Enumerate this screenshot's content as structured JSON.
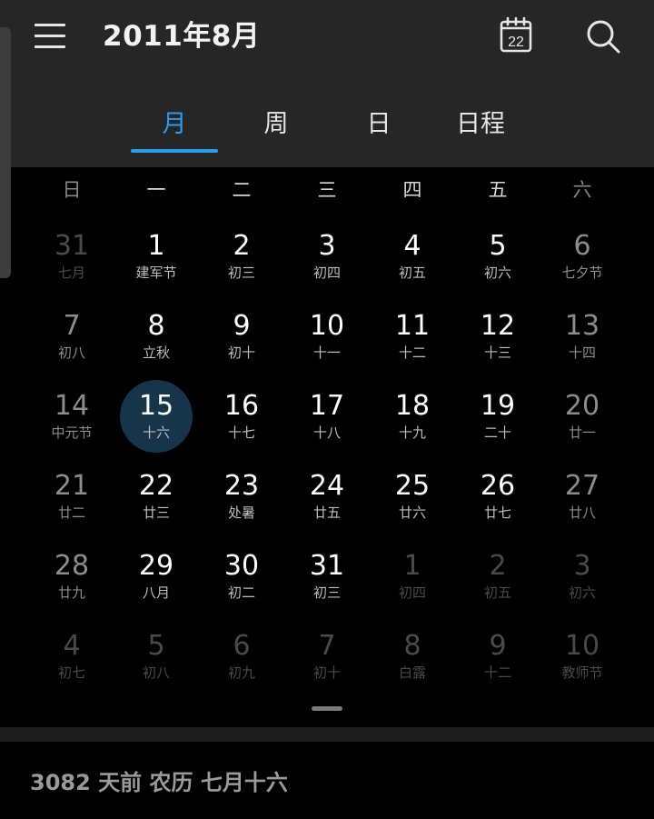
{
  "header": {
    "title": "2011年8月",
    "today_icon_day": "22",
    "icons": {
      "menu": "hamburger-menu-icon",
      "today": "calendar-today-icon",
      "search": "search-icon"
    }
  },
  "tabs": [
    {
      "label": "月",
      "active": true
    },
    {
      "label": "周",
      "active": false
    },
    {
      "label": "日",
      "active": false
    },
    {
      "label": "日程",
      "active": false
    }
  ],
  "weekdays": [
    "日",
    "一",
    "二",
    "三",
    "四",
    "五",
    "六"
  ],
  "weeks": [
    [
      {
        "day": "31",
        "lunar": "七月",
        "other": true
      },
      {
        "day": "1",
        "lunar": "建军节"
      },
      {
        "day": "2",
        "lunar": "初三"
      },
      {
        "day": "3",
        "lunar": "初四"
      },
      {
        "day": "4",
        "lunar": "初五"
      },
      {
        "day": "5",
        "lunar": "初六"
      },
      {
        "day": "6",
        "lunar": "七夕节"
      }
    ],
    [
      {
        "day": "7",
        "lunar": "初八"
      },
      {
        "day": "8",
        "lunar": "立秋"
      },
      {
        "day": "9",
        "lunar": "初十"
      },
      {
        "day": "10",
        "lunar": "十一"
      },
      {
        "day": "11",
        "lunar": "十二"
      },
      {
        "day": "12",
        "lunar": "十三"
      },
      {
        "day": "13",
        "lunar": "十四"
      }
    ],
    [
      {
        "day": "14",
        "lunar": "中元节"
      },
      {
        "day": "15",
        "lunar": "十六",
        "selected": true
      },
      {
        "day": "16",
        "lunar": "十七"
      },
      {
        "day": "17",
        "lunar": "十八"
      },
      {
        "day": "18",
        "lunar": "十九"
      },
      {
        "day": "19",
        "lunar": "二十"
      },
      {
        "day": "20",
        "lunar": "廿一"
      }
    ],
    [
      {
        "day": "21",
        "lunar": "廿二"
      },
      {
        "day": "22",
        "lunar": "廿三"
      },
      {
        "day": "23",
        "lunar": "处暑"
      },
      {
        "day": "24",
        "lunar": "廿五"
      },
      {
        "day": "25",
        "lunar": "廿六"
      },
      {
        "day": "26",
        "lunar": "廿七"
      },
      {
        "day": "27",
        "lunar": "廿八"
      }
    ],
    [
      {
        "day": "28",
        "lunar": "廿九"
      },
      {
        "day": "29",
        "lunar": "八月"
      },
      {
        "day": "30",
        "lunar": "初二"
      },
      {
        "day": "31",
        "lunar": "初三"
      },
      {
        "day": "1",
        "lunar": "初四",
        "other": true
      },
      {
        "day": "2",
        "lunar": "初五",
        "other": true
      },
      {
        "day": "3",
        "lunar": "初六",
        "other": true
      }
    ],
    [
      {
        "day": "4",
        "lunar": "初七",
        "other": true
      },
      {
        "day": "5",
        "lunar": "初八",
        "other": true
      },
      {
        "day": "6",
        "lunar": "初九",
        "other": true
      },
      {
        "day": "7",
        "lunar": "初十",
        "other": true
      },
      {
        "day": "8",
        "lunar": "白露",
        "other": true
      },
      {
        "day": "9",
        "lunar": "十二",
        "other": true
      },
      {
        "day": "10",
        "lunar": "教师节",
        "other": true
      }
    ]
  ],
  "footer": {
    "text": "3082 天前  农历 七月十六"
  },
  "colors": {
    "accent": "#2a9cf0",
    "selected_bg": "#16354a",
    "header_bg": "#262626",
    "page_bg": "#000000"
  }
}
